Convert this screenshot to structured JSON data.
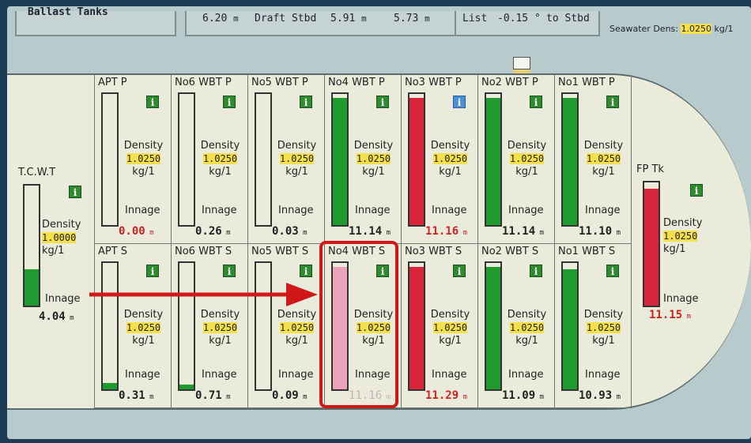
{
  "top": {
    "ballast_label": "Ballast Tanks",
    "draft_port_value": "6.20",
    "draft_stbd_label": "Draft Stbd",
    "draft_stbd_value1": "5.91",
    "draft_stbd_value2": "5.73",
    "unit_m": "m",
    "list_label": "List",
    "list_value": "-0.15",
    "list_unit": "°",
    "list_side": "to Stbd",
    "seawater_label": "Seawater Dens:",
    "seawater_value": "1.0250",
    "seawater_unit": "kg/1"
  },
  "labels": {
    "density": "Density",
    "innage": "Innage",
    "kg": "kg/1",
    "info": "i"
  },
  "tanks": {
    "tcwt": {
      "name": "T.C.W.T",
      "density": "1.0000",
      "innage": "4.04",
      "fill": 0.3
    },
    "apt_p": {
      "name": "APT P",
      "density": "1.0250",
      "innage": "0.00",
      "fill": 0
    },
    "no6_p": {
      "name": "No6 WBT P",
      "density": "1.0250",
      "innage": "0.26",
      "fill": 0
    },
    "no5_p": {
      "name": "No5 WBT P",
      "density": "1.0250",
      "innage": "0.03",
      "fill": 0
    },
    "no4_p": {
      "name": "No4 WBT P",
      "density": "1.0250",
      "innage": "11.14",
      "fill": 0.97
    },
    "no3_p": {
      "name": "No3 WBT P",
      "density": "1.0250",
      "innage": "11.16",
      "fill": 0.97
    },
    "no2_p": {
      "name": "No2 WBT P",
      "density": "1.0250",
      "innage": "11.14",
      "fill": 0.97
    },
    "no1_p": {
      "name": "No1 WBT P",
      "density": "1.0250",
      "innage": "11.10",
      "fill": 0.97
    },
    "apt_s": {
      "name": "APT S",
      "density": "1.0250",
      "innage": "0.31",
      "fill": 0.05
    },
    "no6_s": {
      "name": "No6 WBT S",
      "density": "1.0250",
      "innage": "0.71",
      "fill": 0.04
    },
    "no5_s": {
      "name": "No5 WBT S",
      "density": "1.0250",
      "innage": "0.09",
      "fill": 0
    },
    "no4_s": {
      "name": "No4 WBT S",
      "density": "1.0250",
      "innage": "11.16",
      "fill": 0.97
    },
    "no3_s": {
      "name": "No3 WBT S",
      "density": "1.0250",
      "innage": "11.29",
      "fill": 0.97
    },
    "no2_s": {
      "name": "No2 WBT S",
      "density": "1.0250",
      "innage": "11.09",
      "fill": 0.97
    },
    "no1_s": {
      "name": "No1 WBT S",
      "density": "1.0250",
      "innage": "10.93",
      "fill": 0.95
    },
    "fp": {
      "name": "FP Tk",
      "density": "1.0250",
      "innage": "11.15",
      "fill": 0.95
    }
  },
  "colors": {
    "green": "#1f9a2e",
    "red": "#d8243a",
    "pink": "#eaa3b9",
    "highlight": "#d11818"
  }
}
